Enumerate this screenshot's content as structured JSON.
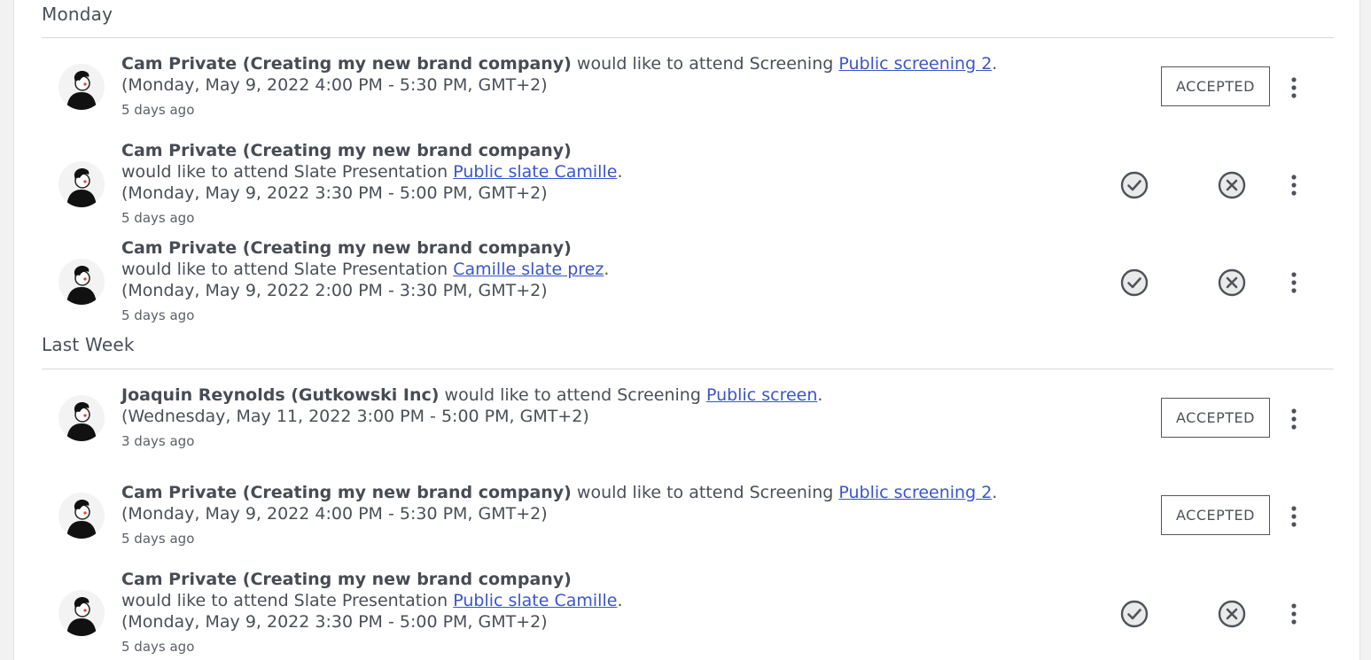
{
  "sections": [
    {
      "title": "Monday",
      "rows": [
        {
          "name": "Cam Private (Creating my new brand company)",
          "action": " would like to attend Screening ",
          "link": "Public screening 2",
          "date": "(Monday, May 9, 2022 4:00 PM - 5:30 PM, GMT+2)",
          "time_ago": "5 days ago",
          "status": "ACCEPTED"
        },
        {
          "name": "Cam Private (Creating my new brand company)",
          "action": "would like to attend Slate Presentation ",
          "link": "Public slate Camille",
          "date": "(Monday, May 9, 2022 3:30 PM - 5:00 PM, GMT+2)",
          "time_ago": "5 days ago",
          "status": "pending"
        },
        {
          "name": "Cam Private (Creating my new brand company)",
          "action": "would like to attend Slate Presentation ",
          "link": "Camille slate prez",
          "date": "(Monday, May 9, 2022 2:00 PM - 3:30 PM, GMT+2)",
          "time_ago": "5 days ago",
          "status": "pending"
        }
      ]
    },
    {
      "title": "Last Week",
      "rows": [
        {
          "name": "Joaquin Reynolds (Gutkowski Inc)",
          "action": " would like to attend Screening ",
          "link": "Public screen",
          "date": "(Wednesday, May 11, 2022 3:00 PM - 5:00 PM, GMT+2)",
          "time_ago": "3 days ago",
          "status": "ACCEPTED"
        },
        {
          "name": "Cam Private (Creating my new brand company)",
          "action": " would like to attend Screening ",
          "link": "Public screening 2",
          "date": "(Monday, May 9, 2022 4:00 PM - 5:30 PM, GMT+2)",
          "time_ago": "5 days ago",
          "status": "ACCEPTED"
        },
        {
          "name": "Cam Private (Creating my new brand company)",
          "action": "would like to attend Slate Presentation ",
          "link": "Public slate Camille",
          "date": "(Monday, May 9, 2022 3:30 PM - 5:00 PM, GMT+2)",
          "time_ago": "5 days ago",
          "status": "pending"
        }
      ]
    }
  ],
  "period": ".",
  "icons": {
    "avatar": "user-avatar-icon",
    "approve": "check-circle-icon",
    "decline": "x-circle-icon",
    "menu": "more-vertical-icon"
  },
  "colors": {
    "link": "#3b55c9",
    "text": "#4a4f57",
    "icon": "#4e535a"
  }
}
